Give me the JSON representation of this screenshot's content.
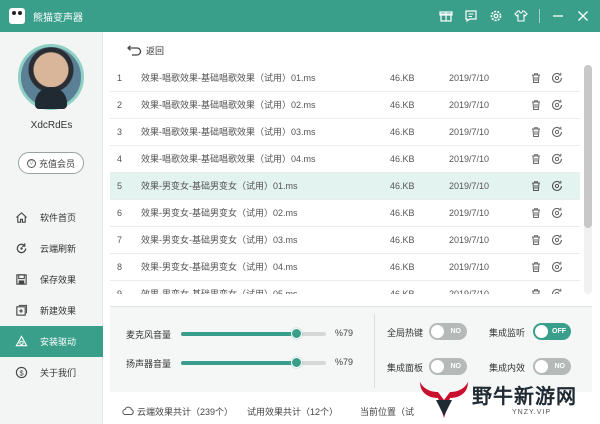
{
  "app": {
    "title": "熊猫变声器",
    "accent_color": "#3a9f8a",
    "title_icons": [
      "gift-icon",
      "message-icon",
      "settings-icon",
      "skin-icon",
      "minimize-icon",
      "close-icon"
    ]
  },
  "sidebar": {
    "username": "XdcRdEs",
    "vip_label": "充值会员",
    "items": [
      {
        "label": "软件首页",
        "icon": "home-icon"
      },
      {
        "label": "云端刷新",
        "icon": "refresh-icon"
      },
      {
        "label": "保存效果",
        "icon": "save-icon"
      },
      {
        "label": "新建效果",
        "icon": "add-icon"
      },
      {
        "label": "安装驱动",
        "icon": "driver-icon",
        "active": true
      },
      {
        "label": "关于我们",
        "icon": "info-icon"
      }
    ]
  },
  "back_label": "返回",
  "files": [
    {
      "index": "1",
      "name": "效果-唱歌效果-基础唱歌效果（试用）01.ms",
      "size": "46.KB",
      "date": "2019/7/10"
    },
    {
      "index": "2",
      "name": "效果-唱歌效果-基础唱歌效果（试用）02.ms",
      "size": "46.KB",
      "date": "2019/7/10"
    },
    {
      "index": "3",
      "name": "效果-唱歌效果-基础唱歌效果（试用）03.ms",
      "size": "46.KB",
      "date": "2019/7/10"
    },
    {
      "index": "4",
      "name": "效果-唱歌效果-基础唱歌效果（试用）04.ms",
      "size": "46.KB",
      "date": "2019/7/10"
    },
    {
      "index": "5",
      "name": "效果-男变女-基础男变女（试用）01.ms",
      "size": "46.KB",
      "date": "2019/7/10",
      "selected": true
    },
    {
      "index": "6",
      "name": "效果-男变女-基础男变女（试用）02.ms",
      "size": "46.KB",
      "date": "2019/7/10"
    },
    {
      "index": "7",
      "name": "效果-男变女-基础男变女（试用）03.ms",
      "size": "46.KB",
      "date": "2019/7/10"
    },
    {
      "index": "8",
      "name": "效果-男变女-基础男变女（试用）04.ms",
      "size": "46.KB",
      "date": "2019/7/10"
    },
    {
      "index": "9",
      "name": "效果-男变女-基础男变女（试用）05.ms",
      "size": "46.KB",
      "date": "2019/7/10"
    }
  ],
  "controls": {
    "mic_volume": {
      "label": "麦克风音量",
      "value_text": "%79",
      "value": 0.79
    },
    "speaker_volume": {
      "label": "扬声器音量",
      "value_text": "%79",
      "value": 0.79
    },
    "global_hotkey": {
      "label": "全局热键",
      "state": "NO",
      "on": false
    },
    "integrated_monitor": {
      "label": "集成监听",
      "state": "OFF",
      "on": true
    },
    "integrated_panel": {
      "label": "集成面板",
      "state": "NO",
      "on": false
    },
    "integrated_internal": {
      "label": "集成内效",
      "state": "NO",
      "on": false
    }
  },
  "status": {
    "cloud_effects": "云端效果共计（239个）",
    "trial_effects": "试用效果共计（12个）",
    "current_position": "当前位置（试"
  },
  "watermark": {
    "text": "野牛新游网",
    "url": "YNZY.VIP"
  }
}
